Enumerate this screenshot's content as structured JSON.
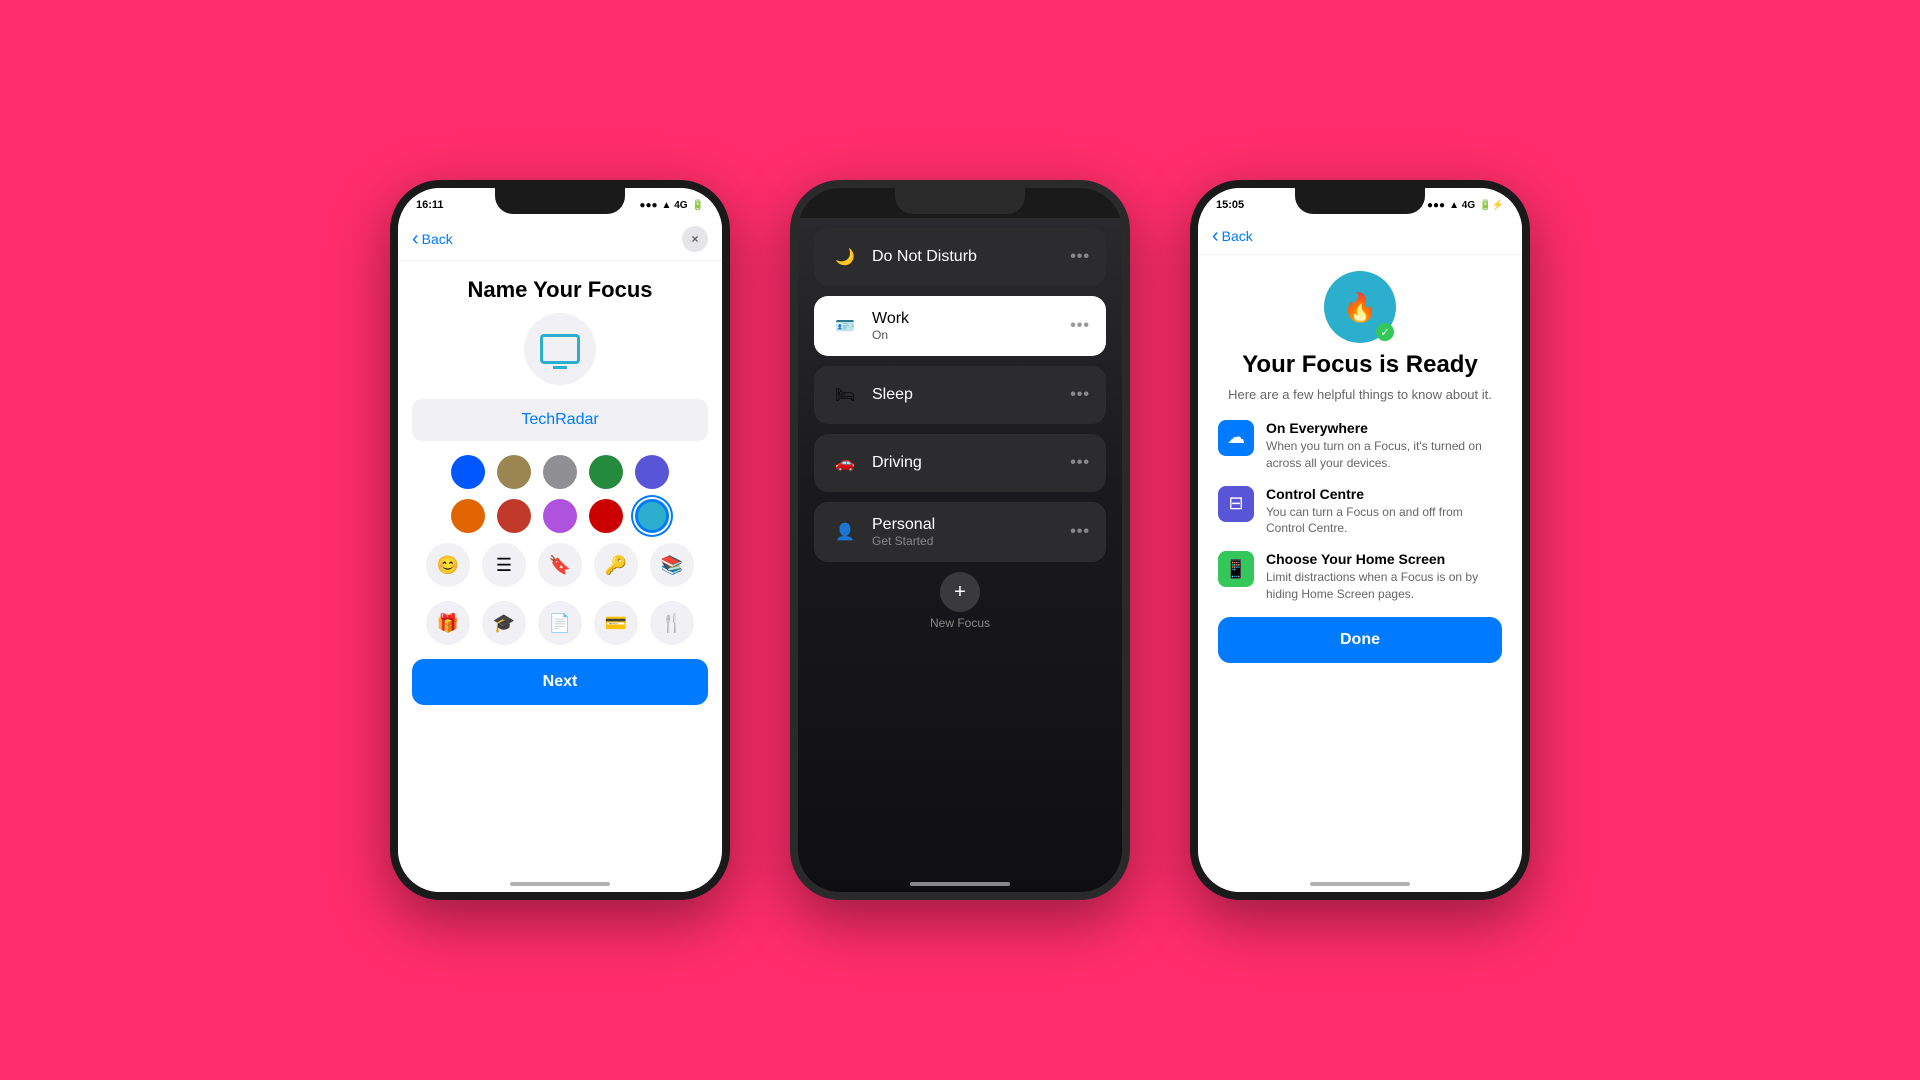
{
  "background": "#FF2D6B",
  "phone1": {
    "status": {
      "time": "16:11",
      "signal": "▲ 4G",
      "battery": "■"
    },
    "back_label": "Back",
    "close_label": "×",
    "title": "Name Your Focus",
    "input_value": "TechRadar",
    "colors": [
      {
        "id": "blue",
        "hex": "#0057FF"
      },
      {
        "id": "tan",
        "hex": "#9B8550"
      },
      {
        "id": "gray",
        "hex": "#8E8E93"
      },
      {
        "id": "green",
        "hex": "#248A3D"
      },
      {
        "id": "indigo",
        "hex": "#5856D6"
      },
      {
        "id": "orange",
        "hex": "#E06400"
      },
      {
        "id": "red1",
        "hex": "#C0392B"
      },
      {
        "id": "purple",
        "hex": "#AF52DE"
      },
      {
        "id": "red2",
        "hex": "#CC0000"
      },
      {
        "id": "teal",
        "hex": "#2BAFCC",
        "selected": true
      }
    ],
    "icons": [
      "😊",
      "☰",
      "🔖",
      "🔑",
      "📚",
      "🎁",
      "🎓",
      "📄",
      "💳",
      "🍴"
    ],
    "next_label": "Next"
  },
  "phone2": {
    "status": {
      "time": "",
      "signal": "",
      "battery": ""
    },
    "items": [
      {
        "id": "do-not-disturb",
        "icon": "🌙",
        "name": "Do Not Disturb",
        "sub": "",
        "active": false
      },
      {
        "id": "work",
        "icon": "🪪",
        "name": "Work",
        "sub": "On",
        "active": true
      },
      {
        "id": "sleep",
        "icon": "🛏",
        "name": "Sleep",
        "sub": "",
        "active": false
      },
      {
        "id": "driving",
        "icon": "🚗",
        "name": "Driving",
        "sub": "",
        "active": false
      },
      {
        "id": "personal",
        "icon": "👤",
        "name": "Personal",
        "sub": "Get Started",
        "active": false
      }
    ],
    "plus_label": "+",
    "new_focus_label": "New Focus"
  },
  "phone3": {
    "status": {
      "time": "15:05",
      "signal": "▲ 4G",
      "battery": "⚡"
    },
    "back_label": "Back",
    "app_icon": "🔥",
    "title": "Your Focus is Ready",
    "subtitle": "Here are a few helpful things to know about it.",
    "features": [
      {
        "id": "on-everywhere",
        "icon": "☁",
        "icon_color": "blue",
        "title": "On Everywhere",
        "desc": "When you turn on a Focus, it's turned on across all your devices."
      },
      {
        "id": "control-centre",
        "icon": "⊟",
        "icon_color": "indigo",
        "title": "Control Centre",
        "desc": "You can turn a Focus on and off from Control Centre."
      },
      {
        "id": "home-screen",
        "icon": "📱",
        "icon_color": "green",
        "title": "Choose Your Home Screen",
        "desc": "Limit distractions when a Focus is on by hiding Home Screen pages."
      }
    ],
    "done_label": "Done"
  }
}
